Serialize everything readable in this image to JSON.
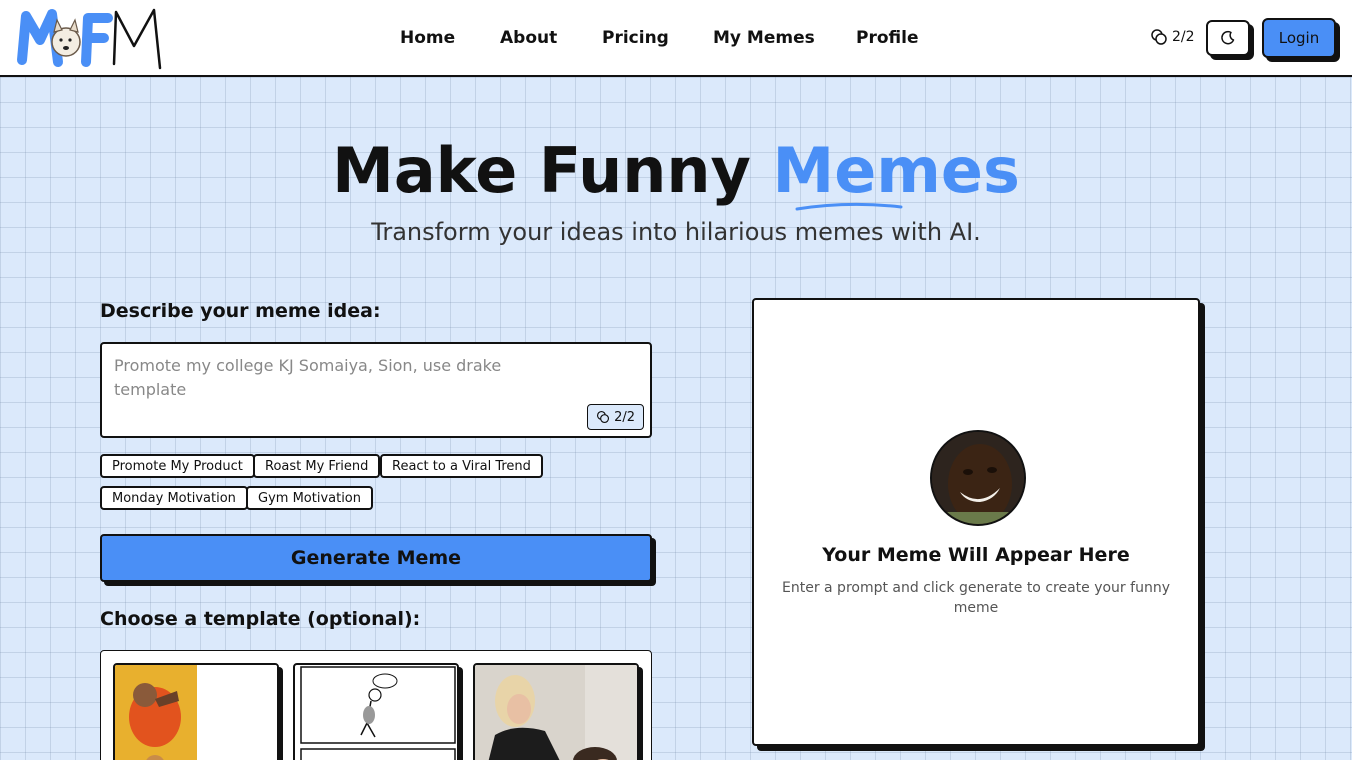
{
  "header": {
    "logo_text": "MFM",
    "nav": [
      "Home",
      "About",
      "Pricing",
      "My Memes",
      "Profile"
    ],
    "credits": "2/2",
    "theme_toggle_icon": "moon-icon",
    "login_label": "Login"
  },
  "hero": {
    "title_main": "Make Funny ",
    "title_accent": "Memes",
    "subtitle": "Transform your ideas into hilarious memes with AI."
  },
  "form": {
    "prompt_label": "Describe your meme idea:",
    "prompt_placeholder": "Promote my college KJ Somaiya, Sion, use drake template",
    "prompt_credits": "2/2",
    "chips": [
      "Promote My Product",
      "Roast My Friend",
      "React to a Viral Trend",
      "Monday Motivation",
      "Gym Motivation"
    ],
    "generate_label": "Generate Meme",
    "template_label": "Choose a template (optional):"
  },
  "preview": {
    "title": "Your Meme Will Appear Here",
    "subtitle": "Enter a prompt and click generate to create your funny meme"
  },
  "colors": {
    "accent": "#4a8ff6",
    "background": "#dbe9fb",
    "border": "#111111"
  }
}
